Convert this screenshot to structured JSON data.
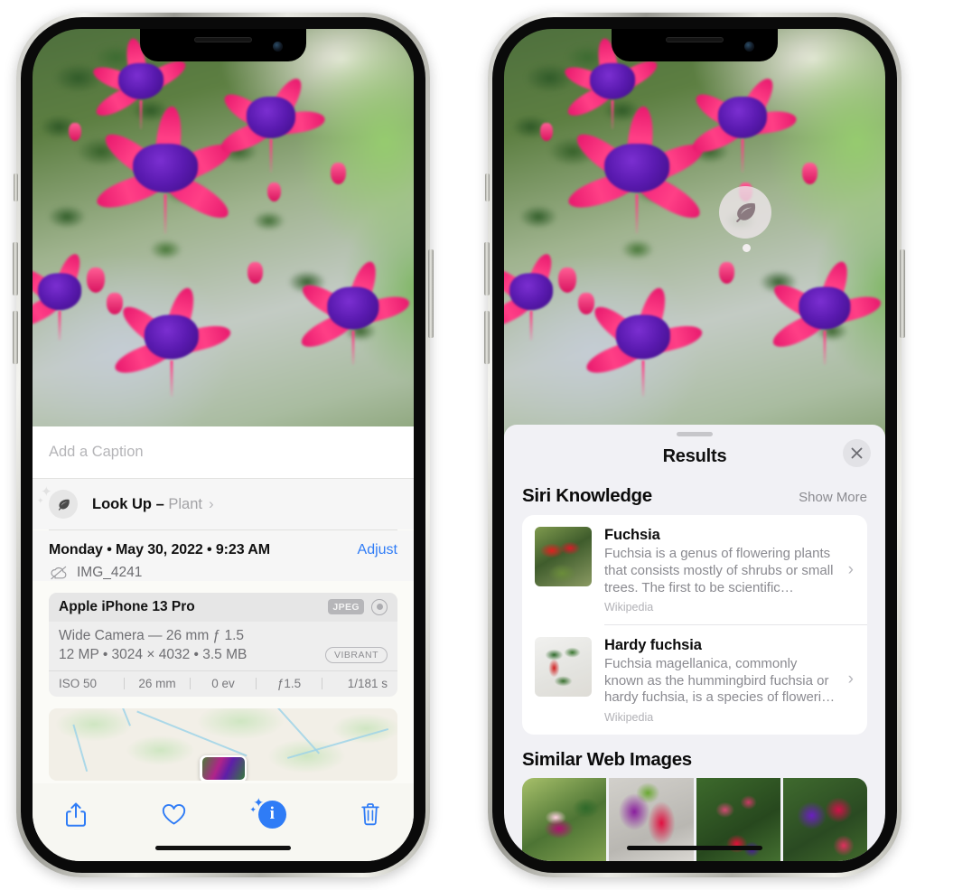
{
  "left_phone": {
    "caption": {
      "placeholder": "Add a Caption"
    },
    "lookup": {
      "label": "Look Up – ",
      "subject": "Plant",
      "chevron": "›",
      "icon": "leaf-icon"
    },
    "meta": {
      "date": "Monday • May 30, 2022 • 9:23 AM",
      "adjust": "Adjust",
      "filename": "IMG_4241",
      "cloud_icon": "icloud-slash-icon"
    },
    "camera_card": {
      "model": "Apple iPhone 13 Pro",
      "format_badge": "JPEG",
      "hdr_icon": "hdr-ring-icon",
      "lens": "Wide Camera — 26 mm ƒ 1.5",
      "specs": "12 MP  •  3024 × 4032  •  3.5 MB",
      "style_badge": "VIBRANT",
      "exif": [
        "ISO 50",
        "26 mm",
        "0 ev",
        "ƒ1.5",
        "1/181 s"
      ]
    },
    "toolbar": [
      {
        "name": "share-button",
        "icon": "share-icon"
      },
      {
        "name": "favorite-button",
        "icon": "heart-icon"
      },
      {
        "name": "info-button",
        "icon": "info-sparkle-icon",
        "glyph": "i"
      },
      {
        "name": "delete-button",
        "icon": "trash-icon"
      }
    ]
  },
  "right_phone": {
    "photo_badge": {
      "icon": "leaf-icon"
    },
    "sheet": {
      "title": "Results",
      "close_icon": "close-icon"
    },
    "siri_knowledge": {
      "heading": "Siri Knowledge",
      "show_more": "Show More",
      "items": [
        {
          "title": "Fuchsia",
          "description": "Fuchsia is a genus of flowering plants that consists mostly of shrubs or small trees. The first to be scientific…",
          "source": "Wikipedia",
          "chevron": "›"
        },
        {
          "title": "Hardy fuchsia",
          "description": "Fuchsia magellanica, commonly known as the hummingbird fuchsia or hardy fuchsia, is a species of floweri…",
          "source": "Wikipedia",
          "chevron": "›"
        }
      ]
    },
    "similar_web_images": {
      "heading": "Similar Web Images",
      "count": 4
    }
  },
  "colors": {
    "accent_blue": "#2f7cf6",
    "sheet_bg": "#f1f1f5",
    "info_bg": "#f6f6f6",
    "card_bg": "#ffffff",
    "secondary_text": "#8a8a90"
  }
}
